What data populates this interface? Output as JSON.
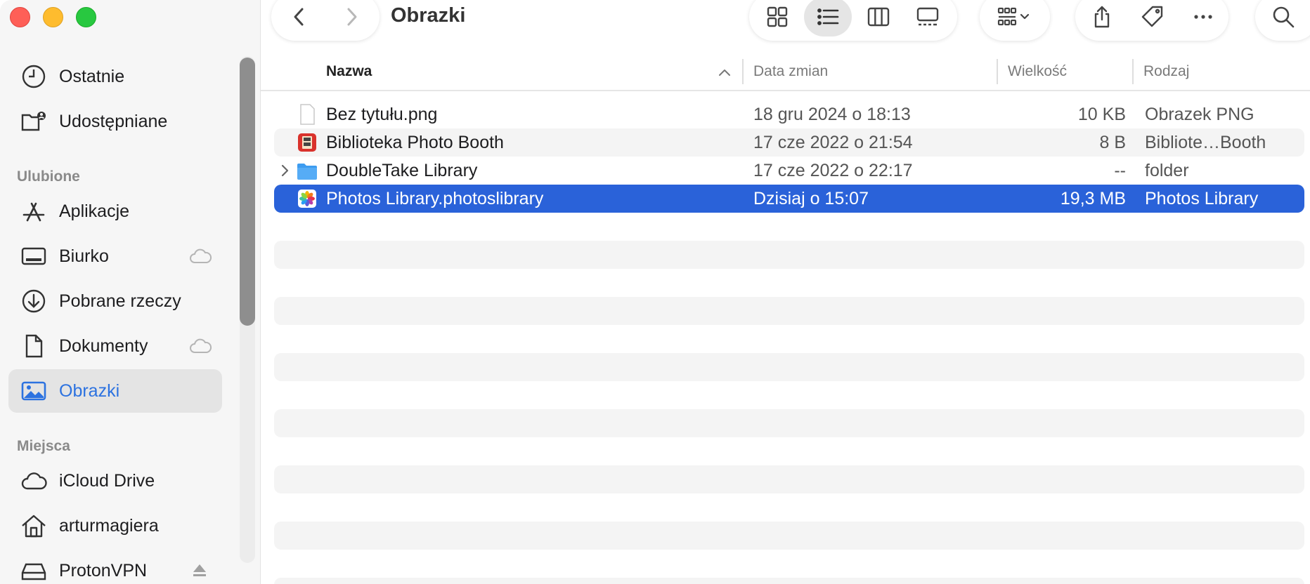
{
  "window": {
    "title": "Obrazki"
  },
  "sidebar": {
    "top_items": [
      {
        "label": "Ostatnie",
        "icon": "clock-icon"
      },
      {
        "label": "Udostępniane",
        "icon": "shared-folder-icon"
      }
    ],
    "favorites_title": "Ulubione",
    "favorites": [
      {
        "label": "Aplikacje",
        "icon": "applications-icon"
      },
      {
        "label": "Biurko",
        "icon": "desktop-icon",
        "icloud": true
      },
      {
        "label": "Pobrane rzeczy",
        "icon": "downloads-icon"
      },
      {
        "label": "Dokumenty",
        "icon": "document-icon",
        "icloud": true
      },
      {
        "label": "Obrazki",
        "icon": "pictures-icon",
        "active": true
      }
    ],
    "locations_title": "Miejsca",
    "locations": [
      {
        "label": "iCloud Drive",
        "icon": "cloud-icon"
      },
      {
        "label": "arturmagiera",
        "icon": "home-icon"
      },
      {
        "label": "ProtonVPN",
        "icon": "drive-icon",
        "ejectable": true
      }
    ]
  },
  "toolbar": {
    "view_modes": [
      "icon-view",
      "list-view",
      "column-view",
      "gallery-view"
    ],
    "selected_view": "list-view"
  },
  "table": {
    "columns": {
      "name": "Nazwa",
      "date": "Data zmian",
      "size": "Wielkość",
      "kind": "Rodzaj"
    },
    "sort_column": "name",
    "sort_direction": "ascending",
    "rows": [
      {
        "name": "Bez tytułu.png",
        "date": "18 gru 2024 o 18:13",
        "size": "10 KB",
        "kind": "Obrazek PNG",
        "icon": "png-file-icon"
      },
      {
        "name": "Biblioteka Photo Booth",
        "date": "17 cze 2022 o 21:54",
        "size": "8 B",
        "kind": "Bibliote…Booth",
        "icon": "photo-booth-icon"
      },
      {
        "name": "DoubleTake Library",
        "date": "17 cze 2022 o 22:17",
        "size": "--",
        "kind": "folder",
        "icon": "folder-icon"
      },
      {
        "name": "Photos Library.photoslibrary",
        "date": "Dzisiaj o 15:07",
        "size": "19,3 MB",
        "kind": "Photos Library",
        "icon": "photos-library-icon",
        "selected": true
      }
    ]
  },
  "colors": {
    "selection": "#2a62d9",
    "sidebar_active_text": "#2c72e0",
    "close": "#fe5f57",
    "minimize": "#febc2e",
    "maximize": "#28c840"
  }
}
